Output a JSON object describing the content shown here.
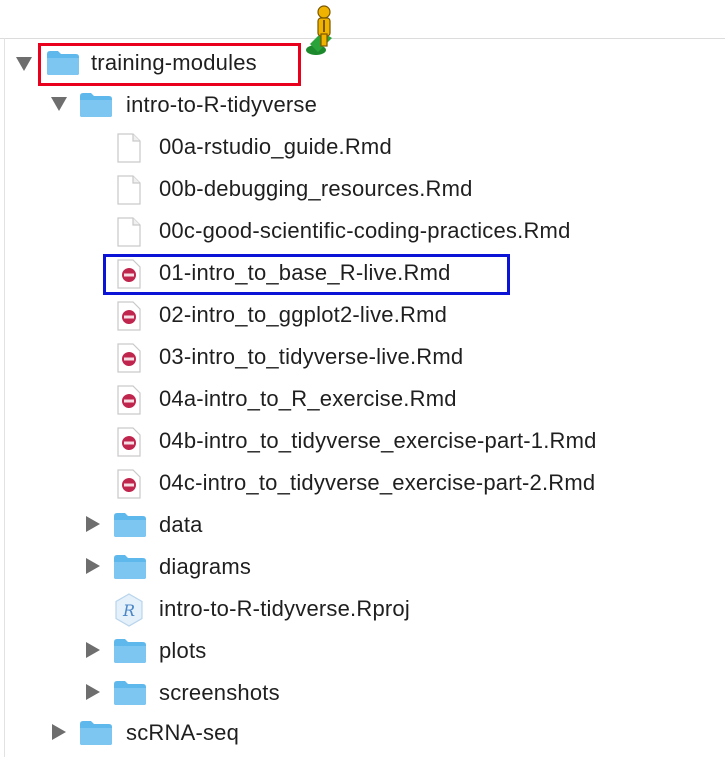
{
  "tree": {
    "root": {
      "label": "training-modules",
      "expanded": true
    },
    "folder": {
      "label": "intro-to-R-tidyverse",
      "expanded": true
    },
    "plain_files": [
      {
        "label": "00a-rstudio_guide.Rmd"
      },
      {
        "label": "00b-debugging_resources.Rmd"
      },
      {
        "label": "00c-good-scientific-coding-practices.Rmd"
      }
    ],
    "rmd_files": [
      {
        "label": "01-intro_to_base_R-live.Rmd",
        "highlighted": true
      },
      {
        "label": "02-intro_to_ggplot2-live.Rmd"
      },
      {
        "label": "03-intro_to_tidyverse-live.Rmd"
      },
      {
        "label": "04a-intro_to_R_exercise.Rmd"
      },
      {
        "label": "04b-intro_to_tidyverse_exercise-part-1.Rmd"
      },
      {
        "label": "04c-intro_to_tidyverse_exercise-part-2.Rmd"
      }
    ],
    "subfolders_a": [
      {
        "label": "data",
        "expanded": false
      },
      {
        "label": "diagrams",
        "expanded": false
      }
    ],
    "rproj": {
      "label": "intro-to-R-tidyverse.Rproj"
    },
    "subfolders_b": [
      {
        "label": "plots",
        "expanded": false
      },
      {
        "label": "screenshots",
        "expanded": false
      }
    ],
    "sibling": {
      "label": "scRNA-seq",
      "expanded": false
    }
  },
  "colors": {
    "folder": "#5fb8ec",
    "folder_tab": "#7cc6f1",
    "rmd_badge": "#c0264d",
    "highlight_red": "#e8001c",
    "highlight_blue": "#0a13d6",
    "pegman": "#f0b400"
  },
  "icons": {
    "folder": "folder-icon",
    "file": "file-icon",
    "rmd": "rmd-file-icon",
    "rproj": "rproj-icon",
    "disclosure_open": "chevron-down-icon",
    "disclosure_closed": "chevron-right-icon",
    "street_view": "pegman-icon"
  }
}
